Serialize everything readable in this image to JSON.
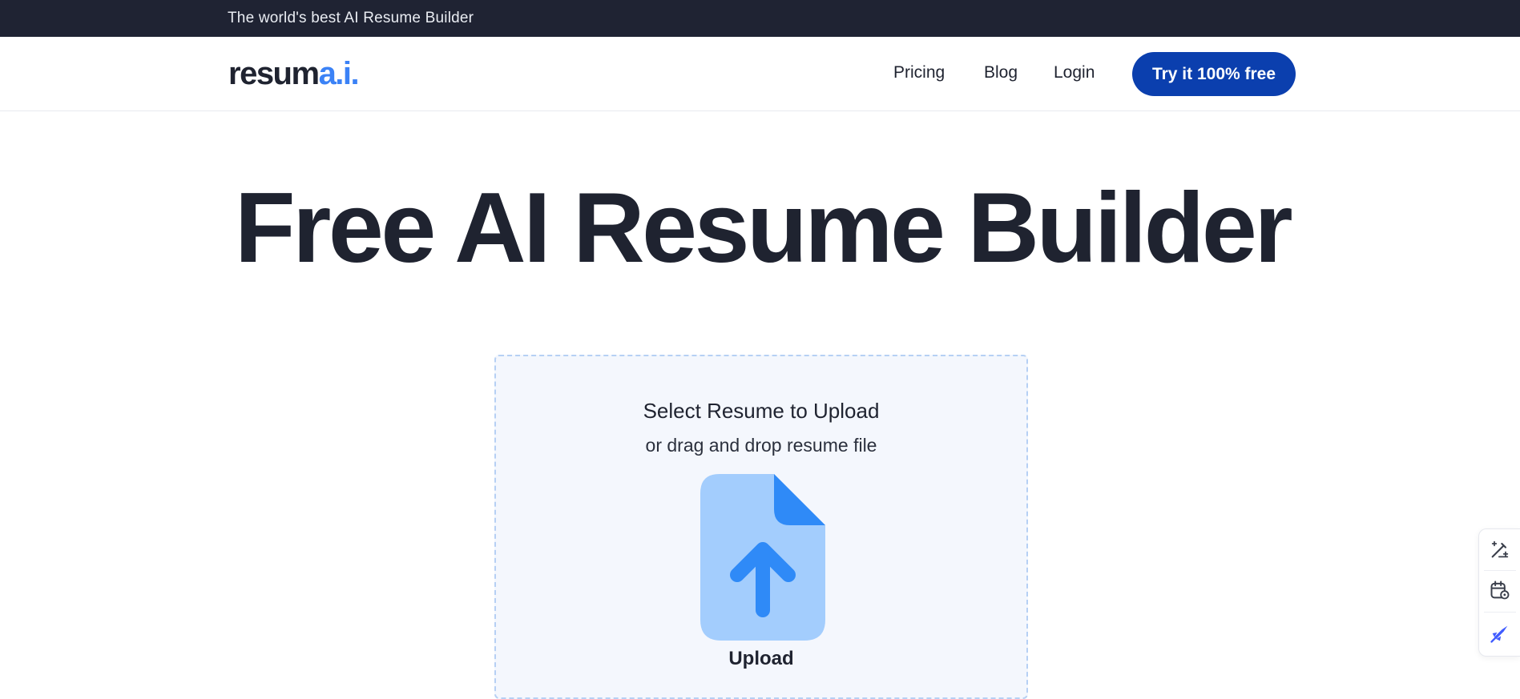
{
  "announcement": {
    "text": "The world's best AI Resume Builder"
  },
  "header": {
    "logo_main": "resum",
    "logo_accent": "a.i.",
    "nav": [
      {
        "label": "Pricing"
      },
      {
        "label": "Blog"
      },
      {
        "label": "Login"
      }
    ],
    "cta_label": "Try it 100% free"
  },
  "hero": {
    "title": "Free AI Resume Builder"
  },
  "upload": {
    "heading": "Select Resume to Upload",
    "subheading": "or drag and drop resume file",
    "icon": "file-upload-icon",
    "label": "Upload"
  },
  "side_toolbar": {
    "icons": [
      "magic-edit-icon",
      "calendar-settings-icon",
      "rocket-icon"
    ]
  },
  "colors": {
    "announce_bg": "#1f2333",
    "brand_accent": "#3b82f6",
    "cta_bg": "#0b3fae",
    "upload_bg": "#f4f7fd",
    "upload_border": "#b6d0f4",
    "icon_light": "#a3cdfd",
    "icon_dark": "#2f8af7"
  }
}
